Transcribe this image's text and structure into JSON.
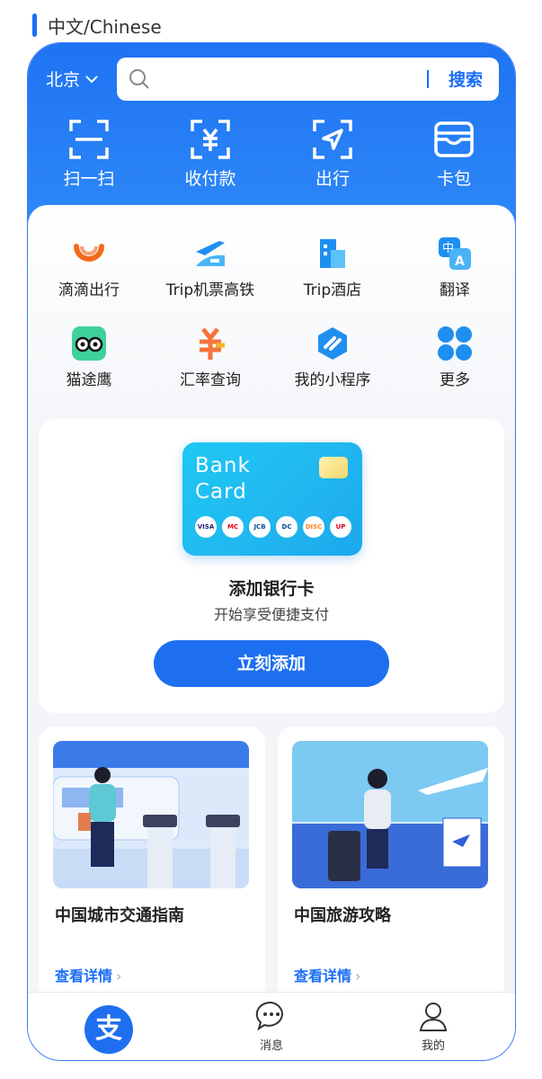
{
  "language_label": "中文/Chinese",
  "header": {
    "city": "北京",
    "search_button": "搜索"
  },
  "quick_actions": [
    {
      "label": "扫一扫",
      "icon": "scan-icon"
    },
    {
      "label": "收付款",
      "icon": "yuan-payment-icon"
    },
    {
      "label": "出行",
      "icon": "navigation-icon"
    },
    {
      "label": "卡包",
      "icon": "wallet-icon"
    }
  ],
  "services": [
    {
      "label": "滴滴出行",
      "icon": "didi-icon",
      "color": "#f26a1b"
    },
    {
      "label": "Trip机票高铁",
      "icon": "plane-train-icon",
      "color": "#1e8ff0"
    },
    {
      "label": "Trip酒店",
      "icon": "hotel-icon",
      "color": "#2a8df2"
    },
    {
      "label": "翻译",
      "icon": "translate-icon",
      "color": "#1e8ff0"
    },
    {
      "label": "猫途鹰",
      "icon": "owl-icon",
      "color": "#3fd19b"
    },
    {
      "label": "汇率查询",
      "icon": "exchange-rate-icon",
      "color": "#f5743b"
    },
    {
      "label": "我的小程序",
      "icon": "miniprogram-icon",
      "color": "#1e8ff0"
    },
    {
      "label": "更多",
      "icon": "more-icon",
      "color": "#1e8ff0"
    }
  ],
  "bank_card": {
    "card_line1": "Bank",
    "card_line2": "Card",
    "logos": [
      "VISA",
      "MC",
      "JCB",
      "DC",
      "DISC",
      "UP"
    ],
    "title": "添加银行卡",
    "subtitle": "开始享受便捷支付",
    "button": "立刻添加"
  },
  "guides": [
    {
      "title": "中国城市交通指南",
      "link": "查看详情"
    },
    {
      "title": "中国旅游攻略",
      "link": "查看详情"
    }
  ],
  "tabbar": {
    "home_glyph": "支",
    "messages": "消息",
    "mine": "我的"
  }
}
